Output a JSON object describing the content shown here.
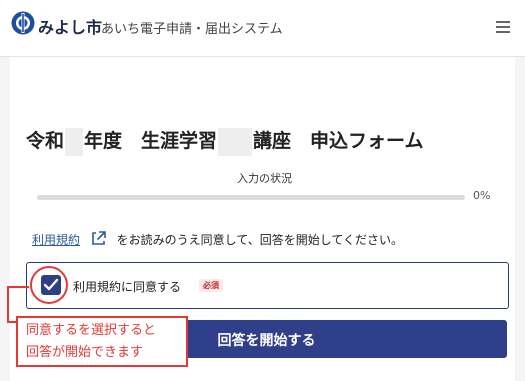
{
  "header": {
    "city_name": "みよし市",
    "system_name": "あいち電子申請・届出システム",
    "logo_icon": "miyoshi-city-emblem",
    "menu_icon": "hamburger-menu-icon"
  },
  "form": {
    "title_parts": [
      "令和",
      "年度　生涯学習",
      "講座　申込フォーム"
    ],
    "progress": {
      "label": "入力の状況",
      "percent_text": "0%",
      "value": 0
    },
    "terms": {
      "link_text": "利用規約",
      "sentence": "をお読みのうえ同意して、回答を開始してください。"
    },
    "agree": {
      "label": "利用規約に同意する",
      "checked": true,
      "required_badge": "必須"
    },
    "start_button": "回答を開始する"
  },
  "annotation": {
    "line1": "同意するを選択すると",
    "line2": "回答が開始できます",
    "color": "#e53935"
  },
  "colors": {
    "accent": "#303f89",
    "link": "#2c5aa0",
    "required": "#c62828"
  }
}
